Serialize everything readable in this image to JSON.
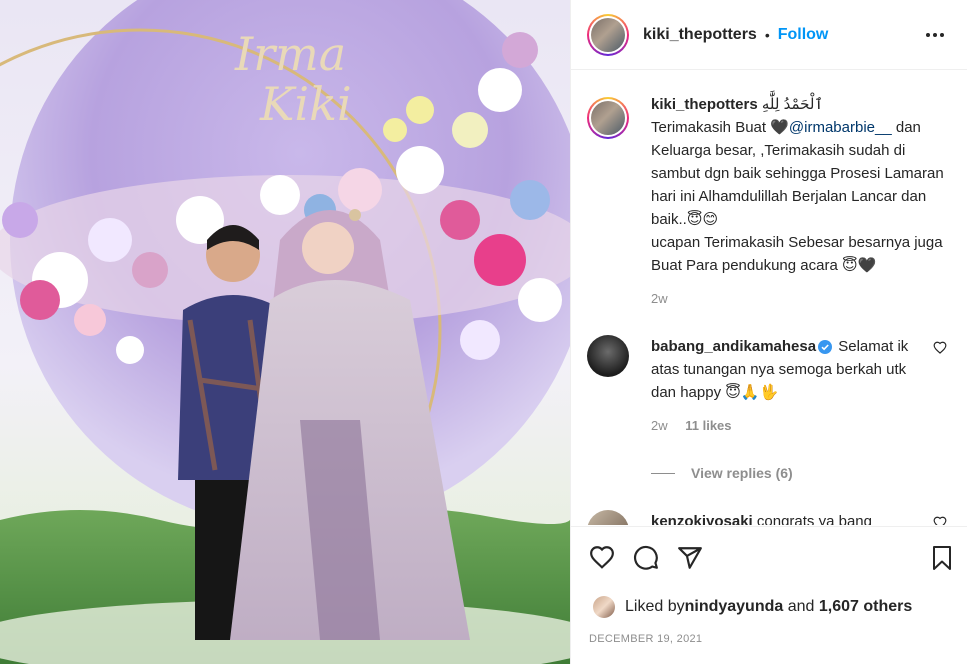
{
  "post": {
    "username": "kiki_thepotters",
    "separator": "•",
    "follow_label": "Follow",
    "more_icon": "more-dots-icon",
    "photo_sign_text_1": "Irma",
    "photo_sign_text_2": "Kiki"
  },
  "caption": {
    "username": "kiki_thepotters",
    "arabic": "ٱلْحَمْدُ لِلَّٰهِ",
    "line_prefix": "Terimakasih Buat 🖤",
    "mention": "@irmabarbie__",
    "text_rest": " dan Keluarga besar, ,Terimakasih sudah di sambut dgn baik sehingga Prosesi Lamaran hari ini Alhamdulillah Berjalan Lancar dan baik..😇😊",
    "text_2": "ucapan Terimakasih Sebesar besarnya juga Buat Para pendukung acara 😇🖤",
    "time": "2w"
  },
  "comments": [
    {
      "username": "babang_andikamahesa",
      "verified": true,
      "text": " Selamat ik atas tunangan nya semoga berkah utk dan happy 😇🙏🖖",
      "time": "2w",
      "likes": "11 likes",
      "view_replies": "View replies (6)"
    },
    {
      "username": "kenzokiyosaki",
      "text": " congrats ya bang"
    }
  ],
  "actions": {
    "like_icon": "heart-icon",
    "comment_icon": "comment-icon",
    "share_icon": "share-icon",
    "save_icon": "bookmark-icon"
  },
  "likes": {
    "prefix": "Liked by ",
    "user": "nindyayunda",
    "mid": " and ",
    "others": "1,607 others"
  },
  "date": "DECEMBER 19, 2021",
  "colors": {
    "accent": "#0095f6",
    "text": "#262626",
    "muted": "#8e8e8e",
    "border": "#efefef"
  }
}
